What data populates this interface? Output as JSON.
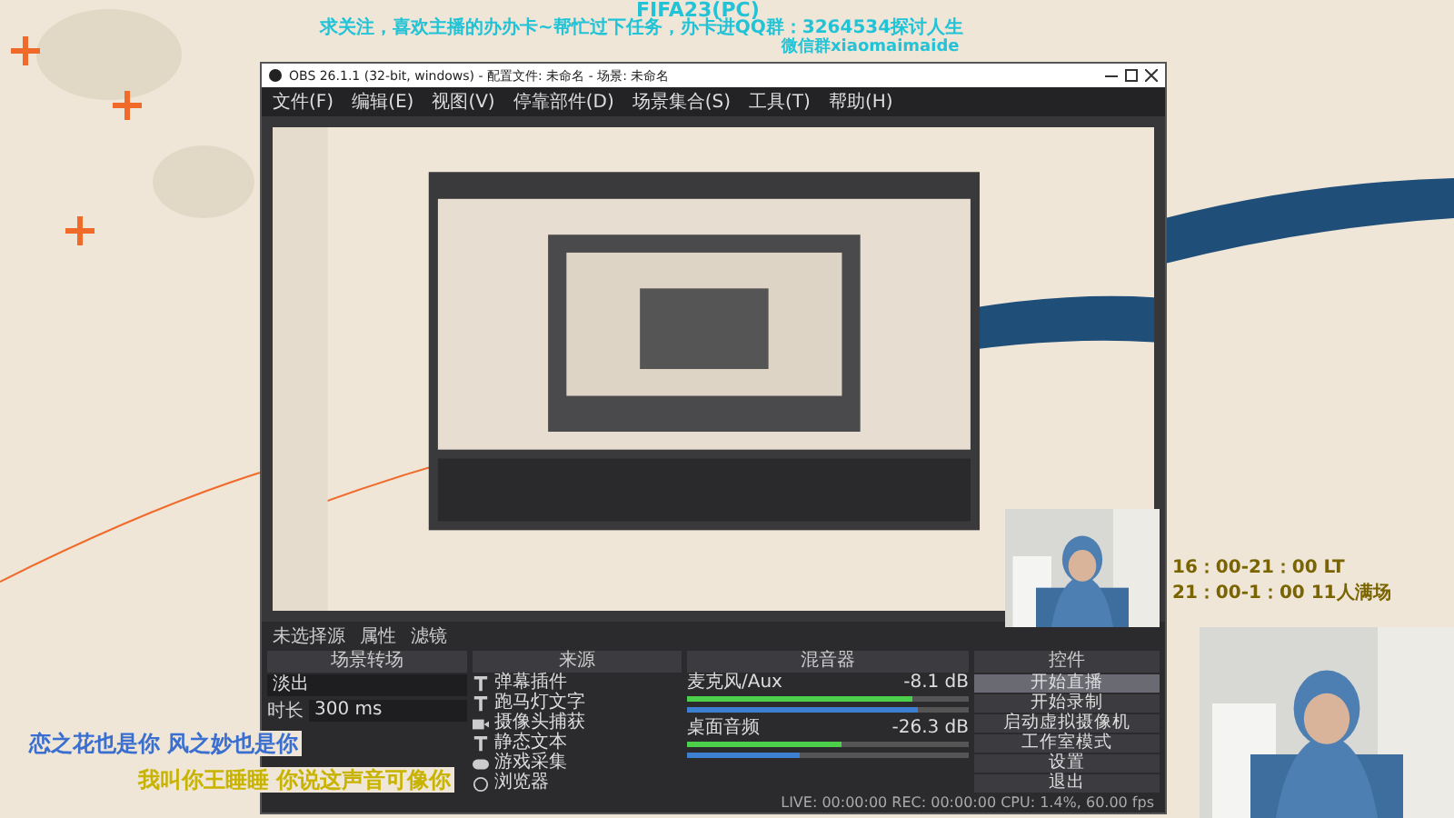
{
  "stream_overlay": {
    "game_title": "FIFA23(PC)",
    "notice": "求关注，喜欢主播的办办卡~帮忙过下任务，办卡进QQ群：3264534探讨人生",
    "wechat": "微信群xiaomaimaide",
    "schedule": [
      "16：00-21：00 LT",
      "21：00-1：00 11人满场"
    ],
    "lyrics": [
      {
        "text": "恋之花也是你 风之妙也是你",
        "color": "#3a6fd0"
      },
      {
        "text": "我叫你王睡睡 你说这声音可像你",
        "color": "#c8b400"
      }
    ]
  },
  "obs": {
    "title": "OBS 26.1.1 (32-bit, windows) - 配置文件: 未命名 - 场景: 未命名",
    "menu": [
      "文件(F)",
      "编辑(E)",
      "视图(V)",
      "停靠部件(D)",
      "场景集合(S)",
      "工具(T)",
      "帮助(H)"
    ],
    "source_bar": {
      "label": "未选择源",
      "buttons": [
        "属性",
        "滤镜"
      ]
    },
    "docks": [
      "场景转场",
      "来源",
      "混音器",
      "控件"
    ],
    "transition": {
      "value": "淡出",
      "duration_label": "时长",
      "duration": "300 ms"
    },
    "sources": [
      {
        "name": "弹幕插件",
        "kind": "text"
      },
      {
        "name": "跑马灯文字",
        "kind": "text"
      },
      {
        "name": "摄像头捕获",
        "kind": "camera"
      },
      {
        "name": "静态文本",
        "kind": "text"
      },
      {
        "name": "游戏采集",
        "kind": "game"
      },
      {
        "name": "浏览器",
        "kind": "browser"
      }
    ],
    "mixer": [
      {
        "name": "麦克风/Aux",
        "reading": "-8.1 dB",
        "level": 0.82
      },
      {
        "name": "桌面音频",
        "reading": "-26.3 dB",
        "level": 0.4
      }
    ],
    "controls": [
      {
        "label": "开始直播",
        "selected": true
      },
      {
        "label": "开始录制",
        "selected": false
      },
      {
        "label": "启动虚拟摄像机",
        "selected": false
      },
      {
        "label": "工作室模式",
        "selected": false
      },
      {
        "label": "设置",
        "selected": false
      },
      {
        "label": "退出",
        "selected": false
      }
    ],
    "status": "LIVE: 00:00:00  REC: 00:00:00  CPU: 1.4%, 60.00 fps"
  }
}
